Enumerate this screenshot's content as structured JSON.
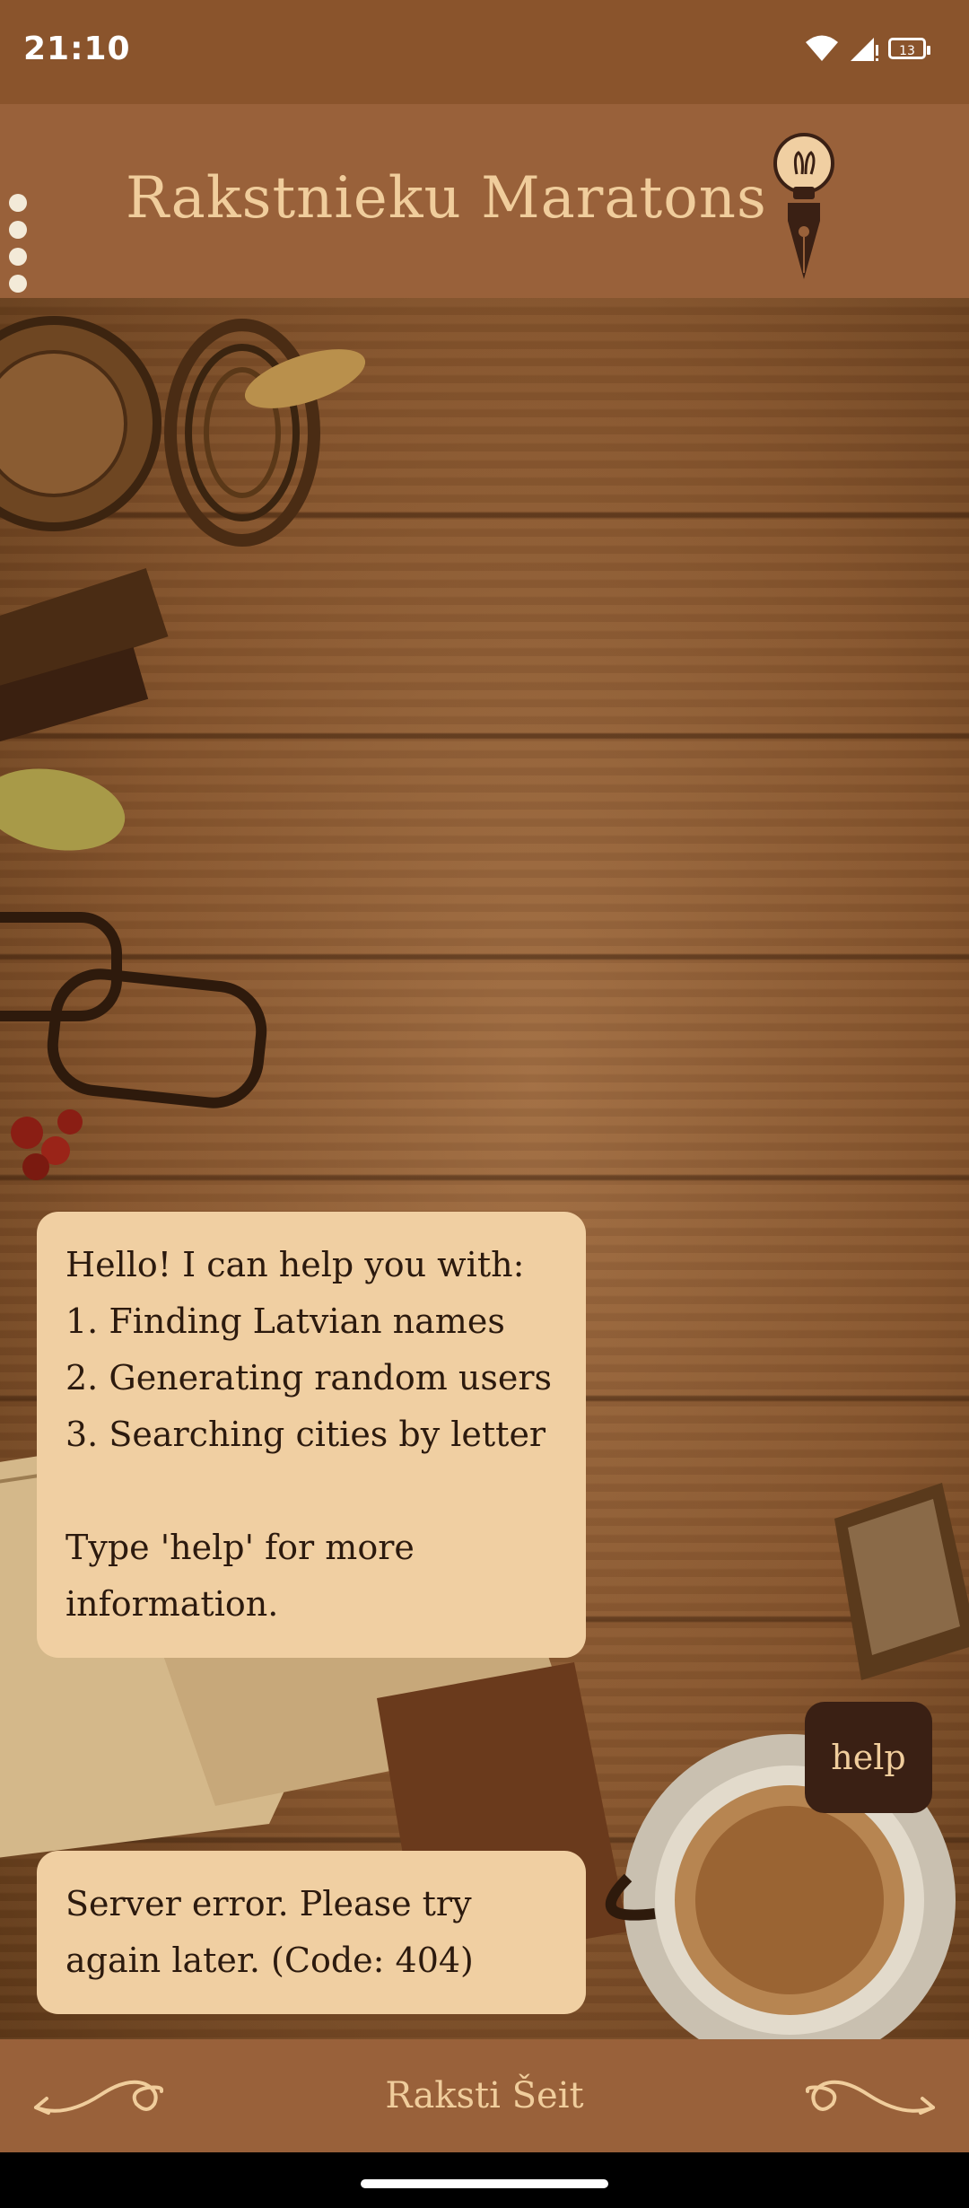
{
  "status_bar": {
    "time": "21:10",
    "battery_level": "13",
    "icons": [
      "wifi-icon",
      "signal-icon",
      "battery-icon"
    ]
  },
  "header": {
    "title": "Rakstnieku Maratons",
    "menu_icon": "more-vert-icon",
    "logo_icon": "lightbulb-pen-icon"
  },
  "chat": {
    "messages": [
      {
        "from": "bot",
        "text": "Hello! I can help you with:\n1. Finding Latvian names\n2. Generating random users\n3. Searching cities by letter\n\nType 'help' for more information."
      },
      {
        "from": "user",
        "text": "help"
      },
      {
        "from": "bot",
        "text": "Server error. Please try again later. (Code: 404)"
      }
    ]
  },
  "input_bar": {
    "placeholder": "Raksti Šeit",
    "left_icon": "swirl-arrow-left-icon",
    "right_icon": "swirl-arrow-right-icon"
  },
  "colors": {
    "status_bar": "#8a542c",
    "header": "#99613a",
    "title_text": "#f0cd9c",
    "bot_bubble": "#f0cfa2",
    "user_bubble": "#3a2014"
  }
}
